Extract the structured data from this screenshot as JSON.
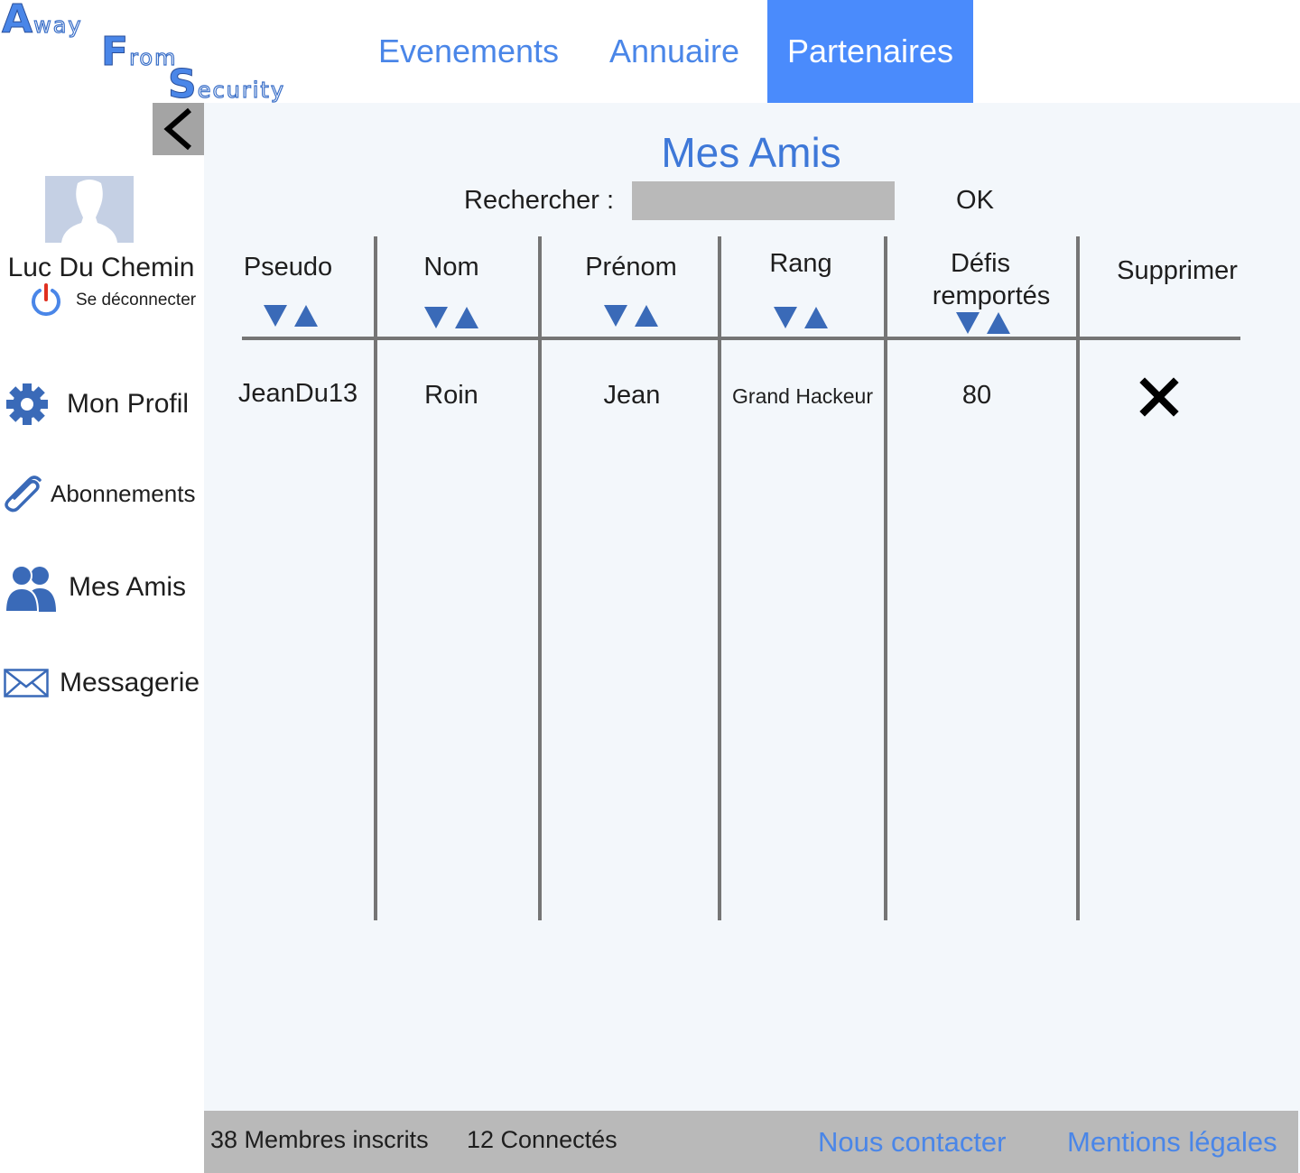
{
  "logo": {
    "line1_initial": "A",
    "line1_rest": "way",
    "line2_initial": "F",
    "line2_rest": "rom",
    "line3_initial": "S",
    "line3_rest": "ecurity"
  },
  "nav": {
    "evenements": "Evenements",
    "annuaire": "Annuaire",
    "partenaires": "Partenaires",
    "active": "partenaires"
  },
  "user": {
    "name": "Luc Du Chemin",
    "logout_label": "Se déconnecter"
  },
  "sidebar": {
    "items": [
      {
        "label": "Mon Profil",
        "icon": "gear-icon"
      },
      {
        "label": "Abonnements",
        "icon": "paperclip-icon"
      },
      {
        "label": "Mes Amis",
        "icon": "users-icon"
      },
      {
        "label": "Messagerie",
        "icon": "envelope-icon"
      }
    ]
  },
  "page": {
    "title": "Mes Amis",
    "search_label": "Rechercher :",
    "search_value": "",
    "ok_label": "OK"
  },
  "table": {
    "headers": {
      "pseudo": "Pseudo",
      "nom": "Nom",
      "prenom": "Prénom",
      "rang": "Rang",
      "defis_line1": "Défis",
      "defis_line2": "remportés",
      "supprimer": "Supprimer"
    },
    "rows": [
      {
        "pseudo": "JeanDu13",
        "nom": "Roin",
        "prenom": "Jean",
        "rang": "Grand Hackeur",
        "defis": "80"
      }
    ]
  },
  "footer": {
    "members": "38 Membres inscrits",
    "connected": "12 Connectés",
    "contact": "Nous contacter",
    "legal": "Mentions légales"
  },
  "colors": {
    "accent": "#4a86e8",
    "nav_active_bg": "#4a8bfc",
    "panel_bg": "#f3f7fb",
    "footer_bg": "#b9b9b9",
    "sort_arrow": "#3a6ab8"
  }
}
